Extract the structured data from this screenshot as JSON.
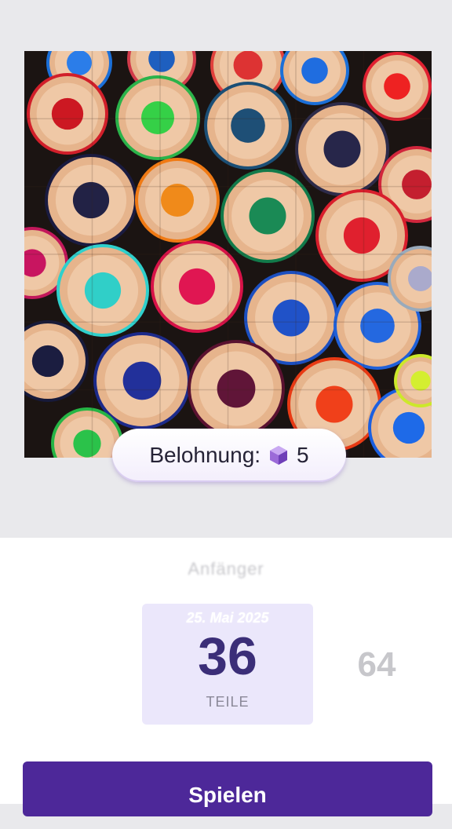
{
  "puzzle": {
    "image_description_icon": "colored-pencils-image",
    "accent": "#4d2899"
  },
  "reward": {
    "label": "Belohnung:",
    "value": "5",
    "icon": "purple-gem-icon"
  },
  "level": {
    "subtitle": "Anfänger"
  },
  "selection": {
    "date": "25. Mai 2025",
    "selected_count": "36",
    "unit": "TEILE",
    "alt_count": "64"
  },
  "actions": {
    "play_label": "Spielen"
  },
  "colors": {
    "primary": "#4d2899",
    "card_bg": "#ebe7fb",
    "count_text": "#3b2e78"
  }
}
